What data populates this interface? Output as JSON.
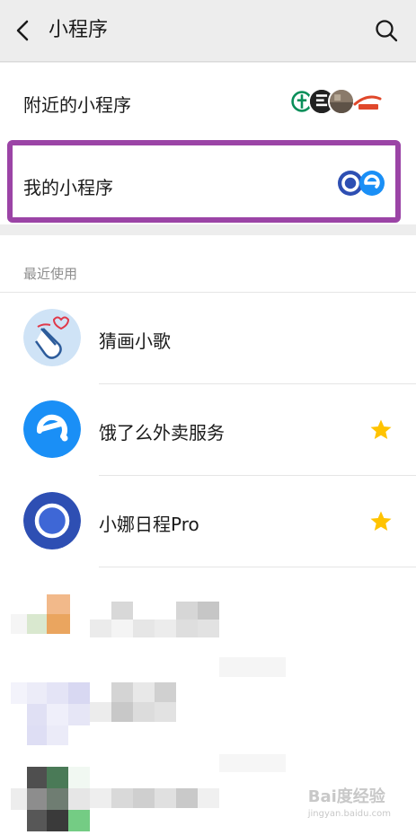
{
  "header": {
    "title": "小程序"
  },
  "nearby": {
    "label": "附近的小程序"
  },
  "mine": {
    "label": "我的小程序"
  },
  "recent": {
    "title": "最近使用",
    "items": [
      {
        "name": "猜画小歌",
        "starred": false
      },
      {
        "name": "饿了么外卖服务",
        "starred": true
      },
      {
        "name": "小娜日程Pro",
        "starred": true
      }
    ]
  },
  "colors": {
    "accent_highlight": "#9b44a6",
    "eleme_blue": "#1a8ff6",
    "star": "#ffc300"
  },
  "watermark": {
    "brand": "Bai度经验",
    "url": "jingyan.baidu.com"
  }
}
